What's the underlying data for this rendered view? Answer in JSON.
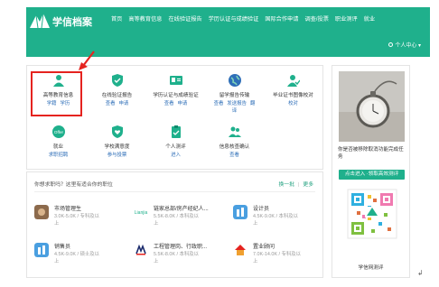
{
  "header": {
    "logo_text": "学信档案",
    "nav": [
      "首页",
      "高等教育信息",
      "在线验证报告",
      "学历认证与成绩验证",
      "国际合作申请",
      "调查/投票",
      "职业测评",
      "就业"
    ],
    "user_center": "个人中心 ▾",
    "bg_color": "#1fb08c"
  },
  "services": [
    {
      "title": "高等教育信息",
      "links": [
        "学籍",
        "学历"
      ],
      "icon": "person-icon"
    },
    {
      "title": "在线验证报告",
      "links": [
        "查看",
        "申请"
      ],
      "icon": "shield-check-icon"
    },
    {
      "title": "学历认证与成绩验证",
      "links": [
        "查看",
        "申请"
      ],
      "icon": "id-card-icon"
    },
    {
      "title": "留学报告传输",
      "links": [
        "查看",
        "发送报告",
        "翻"
      ],
      "extra": "译",
      "icon": "globe-icon"
    },
    {
      "title": "毕业证书图像校对",
      "links": [
        "校对"
      ],
      "icon": "person-check-icon"
    },
    {
      "title": "就业",
      "links": [
        "求职招聘"
      ],
      "icon": "offer-icon",
      "badge": "Offer"
    },
    {
      "title": "学校满意度",
      "links": [
        "参与投票"
      ],
      "icon": "shield-heart-icon"
    },
    {
      "title": "个人测评",
      "links": [
        "进入"
      ],
      "icon": "clipboard-icon"
    },
    {
      "title": "信息核查确认",
      "links": [
        "查看"
      ],
      "icon": "people-icon"
    }
  ],
  "jobs": {
    "heading": "你想求职吗？这里有适合你的职位",
    "refresh": "换一批",
    "more": "更多",
    "items": [
      {
        "title": "市场管理生",
        "detail": "3.0K-5.0K / 专科及以",
        "detail2": "上"
      },
      {
        "title": "链家总部/房产经纪人...",
        "detail": "5.5K-8.0K / 本科及以",
        "detail2": "上"
      },
      {
        "title": "设计员",
        "detail": "4.5K-9.0K / 本科及以",
        "detail2": "上"
      },
      {
        "title": "销售员",
        "detail": "4.5K-9.0K / 硕士及以",
        "detail2": "上"
      },
      {
        "title": "工程管理岗、行政职...",
        "detail": "5.5K-8.0K / 本科及以",
        "detail2": "上"
      },
      {
        "title": "置业顾问",
        "detail": "7.0K-14.0K / 专科及以",
        "detail2": "上"
      }
    ]
  },
  "sidebar": {
    "caption": "你是否被移除取消功能完成任务",
    "button": "点击进入 ·领取高效测评",
    "qr_label": "学信网测评"
  }
}
